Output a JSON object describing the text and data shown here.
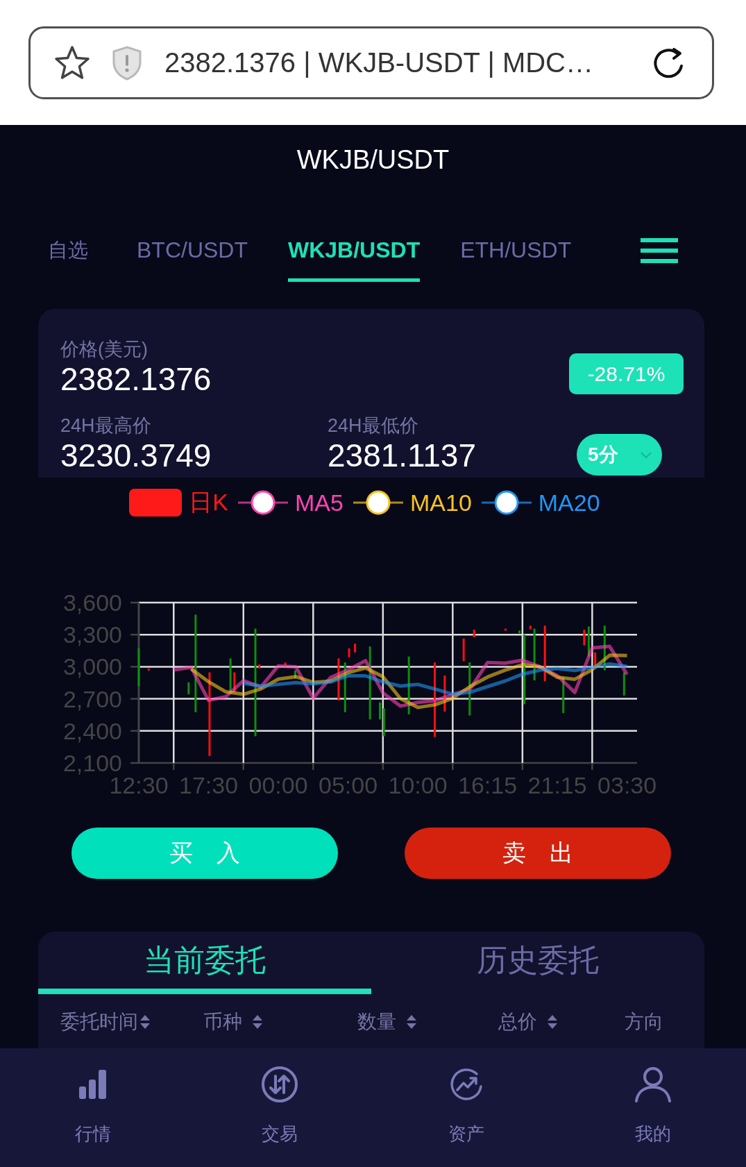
{
  "browser": {
    "address": "2382.1376 | WKJB-USDT | MDC…"
  },
  "header": {
    "title": "WKJB/USDT"
  },
  "pair_tabs": [
    {
      "label": "自选",
      "selected": false
    },
    {
      "label": "BTC/USDT",
      "selected": false
    },
    {
      "label": "WKJB/USDT",
      "selected": true
    },
    {
      "label": "ETH/USDT",
      "selected": false
    }
  ],
  "price_card": {
    "price_label": "价格(美元)",
    "price": "2382.1376",
    "change": "-28.71%",
    "high_label": "24H最高价",
    "high": "3230.3749",
    "low_label": "24H最低价",
    "low": "2381.1137",
    "interval": "5分"
  },
  "chart": {
    "candle_legend": {
      "label": "日K",
      "color": "#ff1a1a"
    },
    "chart_data": {
      "type": "line",
      "grid": true,
      "categories": [
        "12:30",
        null,
        null,
        null,
        "17:30",
        null,
        null,
        null,
        "00:00",
        null,
        null,
        null,
        "05:00",
        null,
        null,
        null,
        "10:00",
        null,
        null,
        null,
        "16:15",
        null,
        null,
        null,
        "21:15",
        null,
        null,
        null,
        "03:30"
      ],
      "ylim": [
        2100,
        3600
      ],
      "yticks": [
        {
          "value": 3600,
          "label": "3,600"
        },
        {
          "value": 3300,
          "label": "3,300"
        },
        {
          "value": 3000,
          "label": "3,000"
        },
        {
          "value": 2700,
          "label": "2,700"
        },
        {
          "value": 2400,
          "label": "2,400"
        },
        {
          "value": 2100,
          "label": "2,100"
        }
      ],
      "series": [
        {
          "name": "MA5",
          "color": "#ff44b4",
          "values": [
            null,
            null,
            2970,
            2995,
            2686,
            2720,
            2870,
            2810,
            3008,
            3000,
            2705,
            2900,
            2970,
            3057,
            2756,
            2632,
            2667,
            2683,
            2738,
            2793,
            3040,
            3033,
            3061,
            3000,
            2917,
            2760,
            3176,
            3190,
            2928
          ]
        },
        {
          "name": "MA10",
          "color": "#f8c31c",
          "values": [
            null,
            null,
            null,
            2980,
            2860,
            2765,
            2742,
            2792,
            2884,
            2907,
            2854,
            2866,
            2944,
            2989,
            2907,
            2702,
            2619,
            2645,
            2705,
            2816,
            2904,
            2968,
            3020,
            3000,
            2902,
            2883,
            2972,
            3108,
            3105
          ]
        },
        {
          "name": "MA20",
          "color": "#2196f3",
          "values": [
            null,
            null,
            null,
            null,
            null,
            null,
            2845,
            2819,
            2835,
            2852,
            2840,
            2858,
            2915,
            2915,
            2858,
            2819,
            2835,
            2790,
            2744,
            2761,
            2814,
            2866,
            2930,
            2968,
            2984,
            2965,
            2993,
            3026,
            3003
          ]
        }
      ]
    }
  },
  "actions": [
    {
      "label": "买　入",
      "kind": "buy"
    },
    {
      "label": "卖　出",
      "kind": "sell"
    }
  ],
  "orders": {
    "tabs": [
      {
        "label": "当前委托",
        "selected": true
      },
      {
        "label": "历史委托",
        "selected": false
      }
    ],
    "columns": [
      {
        "label": "委托时间",
        "sortable": true
      },
      {
        "label": "币种",
        "sortable": true
      },
      {
        "label": "数量",
        "sortable": true
      },
      {
        "label": "总价",
        "sortable": true
      },
      {
        "label": "方向",
        "sortable": false
      }
    ]
  },
  "bottom_nav": [
    {
      "label": "行情",
      "kind": "market"
    },
    {
      "label": "交易",
      "kind": "trade"
    },
    {
      "label": "资产",
      "kind": "assets"
    },
    {
      "label": "我的",
      "kind": "profile"
    }
  ]
}
